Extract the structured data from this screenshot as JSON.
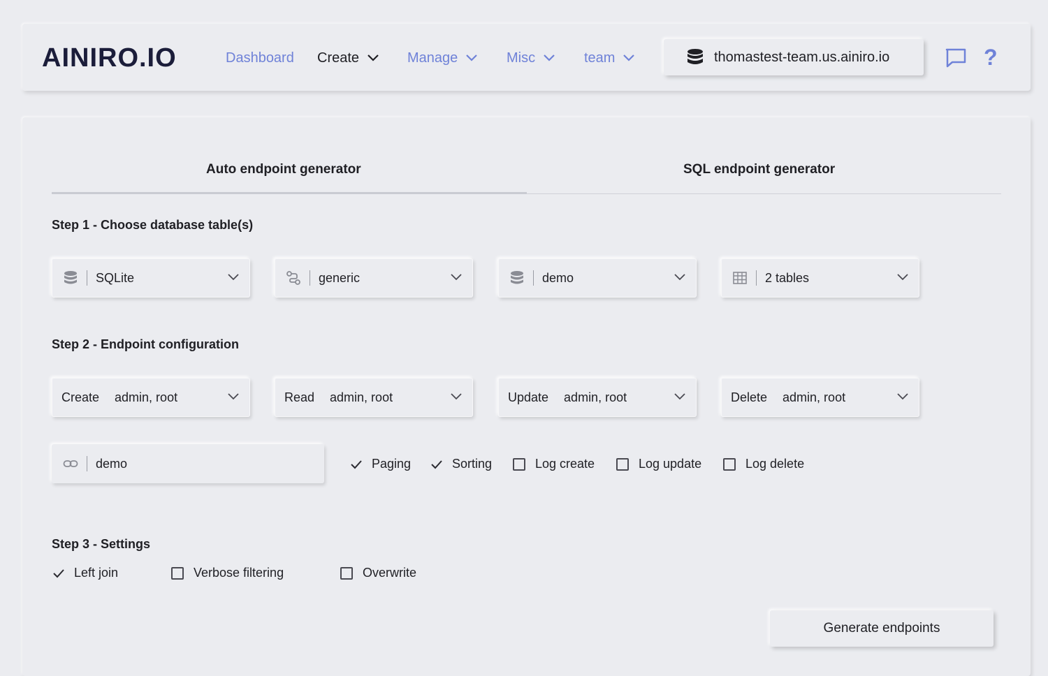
{
  "brand": {
    "logo_text": "AINIRO.IO"
  },
  "nav": {
    "dashboard": "Dashboard",
    "create": "Create",
    "manage": "Manage",
    "misc": "Misc",
    "team": "team"
  },
  "host": {
    "name": "thomastest-team.us.ainiro.io"
  },
  "tabs": {
    "auto": "Auto endpoint generator",
    "sql": "SQL endpoint generator",
    "active": "auto"
  },
  "step1": {
    "title": "Step 1 - Choose database table(s)",
    "db_type": "SQLite",
    "connection": "generic",
    "database": "demo",
    "tables": "2 tables"
  },
  "step2": {
    "title": "Step 2 - Endpoint configuration",
    "create_label": "Create",
    "create_roles": "admin, root",
    "read_label": "Read",
    "read_roles": "admin, root",
    "update_label": "Update",
    "update_roles": "admin, root",
    "delete_label": "Delete",
    "delete_roles": "admin, root",
    "url": "demo",
    "options": {
      "paging": {
        "label": "Paging",
        "checked": true
      },
      "sorting": {
        "label": "Sorting",
        "checked": true
      },
      "log_create": {
        "label": "Log create",
        "checked": false
      },
      "log_update": {
        "label": "Log update",
        "checked": false
      },
      "log_delete": {
        "label": "Log delete",
        "checked": false
      }
    }
  },
  "step3": {
    "title": "Step 3 - Settings",
    "left_join": {
      "label": "Left join",
      "checked": true
    },
    "verbose_filtering": {
      "label": "Verbose filtering",
      "checked": false
    },
    "overwrite": {
      "label": "Overwrite",
      "checked": false
    }
  },
  "actions": {
    "generate": "Generate endpoints"
  },
  "colors": {
    "accent": "#6f82d8",
    "brand_dark": "#1b1d3a",
    "background": "#ebecf0"
  }
}
